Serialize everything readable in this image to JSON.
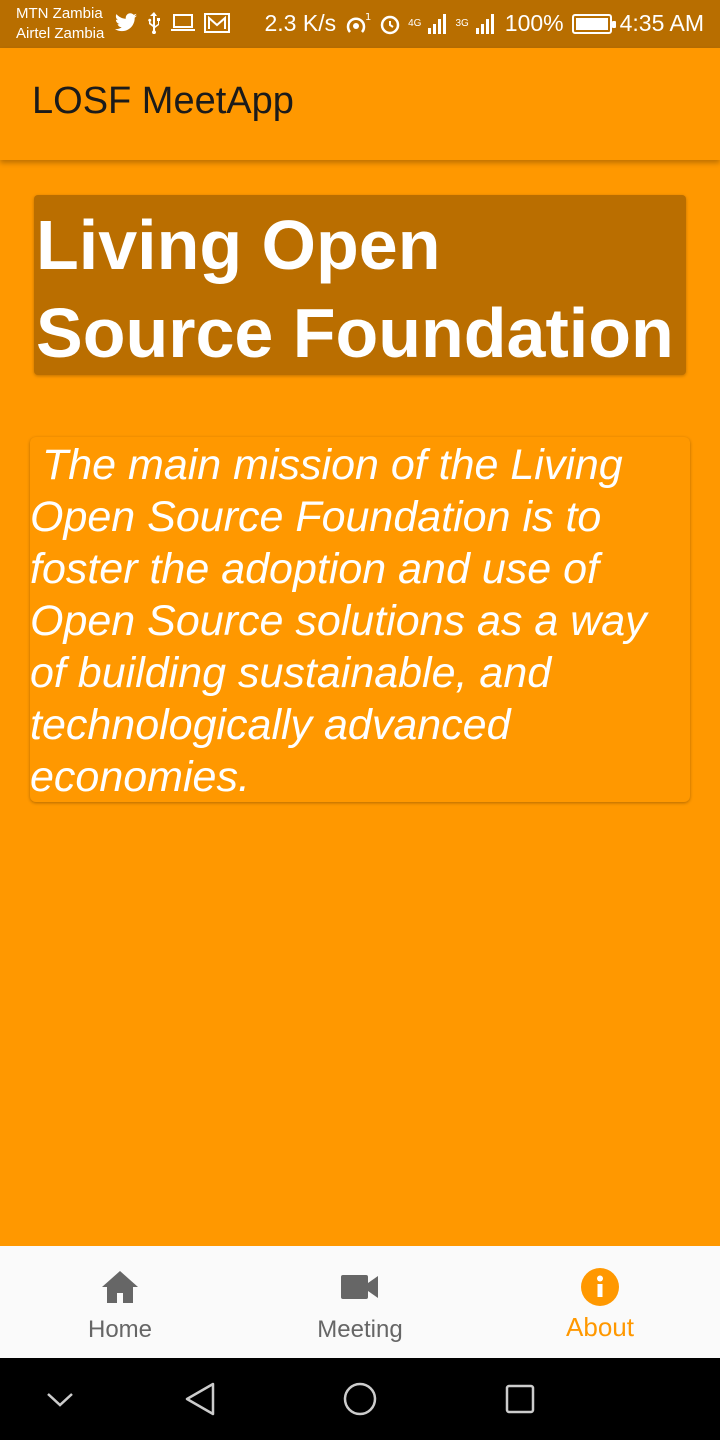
{
  "status_bar": {
    "carrier_1": "MTN Zambia",
    "carrier_2": "Airtel Zambia",
    "speed": "2.3 K/s",
    "network_1": "4G",
    "network_2": "3G",
    "battery": "100%",
    "time": "4:35 AM",
    "notification_icons": [
      "twitter-icon",
      "usb-icon",
      "laptop-icon",
      "mail-icon"
    ]
  },
  "app_bar": {
    "title": "LOSF MeetApp"
  },
  "main": {
    "title": "Living Open Source Foundation",
    "mission": " The main mission of the Living Open Source Foundation is to foster the adoption and use of Open Source solutions as a way of building sustainable, and technologically advanced economies."
  },
  "bottom_nav": {
    "items": [
      {
        "label": "Home",
        "icon": "home-icon",
        "active": false
      },
      {
        "label": "Meeting",
        "icon": "video-camera-icon",
        "active": false
      },
      {
        "label": "About",
        "icon": "info-icon",
        "active": true
      }
    ]
  },
  "colors": {
    "primary": "#FF9800",
    "dark_primary": "#B86E00",
    "inactive": "#666666",
    "nav_background": "#FAFAFA"
  }
}
